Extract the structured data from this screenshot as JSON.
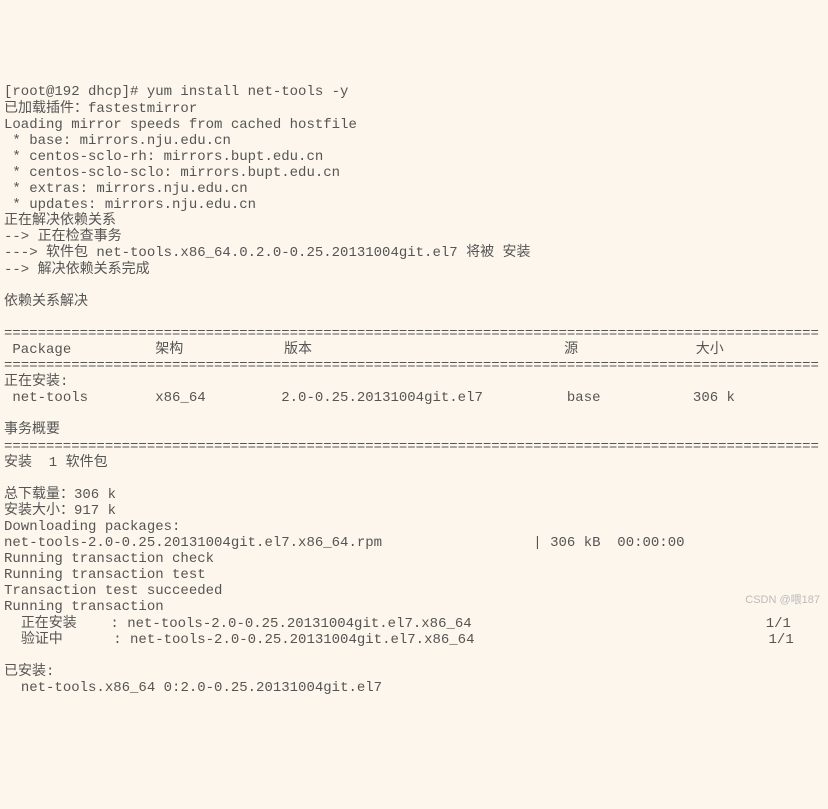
{
  "lines": {
    "l0": "[root@192 dhcp]# yum install net-tools -y",
    "l1": "已加载插件：fastestmirror",
    "l2": "Loading mirror speeds from cached hostfile",
    "l3": " * base: mirrors.nju.edu.cn",
    "l4": " * centos-sclo-rh: mirrors.bupt.edu.cn",
    "l5": " * centos-sclo-sclo: mirrors.bupt.edu.cn",
    "l6": " * extras: mirrors.nju.edu.cn",
    "l7": " * updates: mirrors.nju.edu.cn",
    "l8": "正在解决依赖关系",
    "l9": "--> 正在检查事务",
    "l10": "---> 软件包 net-tools.x86_64.0.2.0-0.25.20131004git.el7 将被 安装",
    "l11": "--> 解决依赖关系完成",
    "l12": "",
    "l13": "依赖关系解决",
    "l14": "",
    "l15": "=================================================================================================",
    "l16": " Package          架构            版本                              源              大小",
    "l17": "=================================================================================================",
    "l18": "正在安装:",
    "l19": " net-tools        x86_64         2.0-0.25.20131004git.el7          base           306 k",
    "l20": "",
    "l21": "事务概要",
    "l22": "=================================================================================================",
    "l23": "安装  1 软件包",
    "l24": "",
    "l25": "总下载量：306 k",
    "l26": "安装大小：917 k",
    "l27": "Downloading packages:",
    "l28": "net-tools-2.0-0.25.20131004git.el7.x86_64.rpm                  | 306 kB  00:00:00",
    "l29": "Running transaction check",
    "l30": "Running transaction test",
    "l31": "Transaction test succeeded",
    "l32": "Running transaction",
    "l33": "  正在安装    : net-tools-2.0-0.25.20131004git.el7.x86_64                                   1/1",
    "l34": "  验证中      : net-tools-2.0-0.25.20131004git.el7.x86_64                                   1/1",
    "l35": "",
    "l36": "已安装:",
    "l37": "  net-tools.x86_64 0:2.0-0.25.20131004git.el7"
  },
  "watermark": "CSDN @喂187"
}
